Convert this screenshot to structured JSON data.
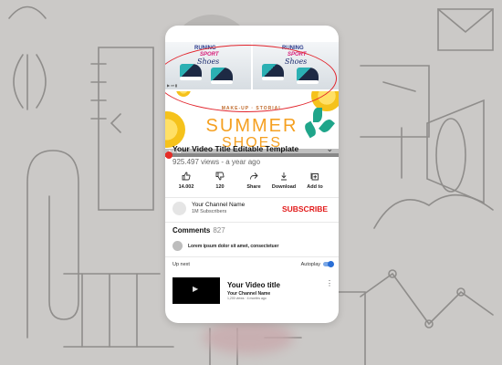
{
  "video": {
    "thumb_brand_line1": "RUNING",
    "thumb_brand_line2": "SPORT",
    "thumb_brand_line3": "Shoes",
    "banner_tag": "MAKE-UP · STORIAL",
    "banner_word1": "SUMMER",
    "banner_word2": "SHOES",
    "progress_fraction": 0.02
  },
  "info": {
    "title": "Your Video Title Editable Template",
    "views": "925.497 views - a year ago"
  },
  "actions": [
    {
      "label": "14.002",
      "icon": "thumbs-up-icon"
    },
    {
      "label": "120",
      "icon": "thumbs-down-icon"
    },
    {
      "label": "Share",
      "icon": "share-icon"
    },
    {
      "label": "Download",
      "icon": "download-icon"
    },
    {
      "label": "Add to",
      "icon": "add-to-playlist-icon"
    }
  ],
  "channel": {
    "name": "Your Channel Name",
    "subscribers": "1M Subscribers",
    "subscribe_label": "SUBSCRIBE"
  },
  "comments": {
    "heading": "Comments",
    "count": "827",
    "top_comment": "Lorem ipsum dolor sit amet, consectetuer"
  },
  "up_next": {
    "label": "Up next",
    "autoplay_label": "Autoplay",
    "autoplay_on": true
  },
  "next_video": {
    "title": "Your Video title",
    "channel": "Your Channel Name",
    "meta": "1,200 views · 4 months ago"
  },
  "colors": {
    "accent_red": "#e21b1b",
    "annotation_oval": "#e2242c",
    "banner_orange": "#f5a021",
    "toggle_blue": "#2a6fd6"
  }
}
